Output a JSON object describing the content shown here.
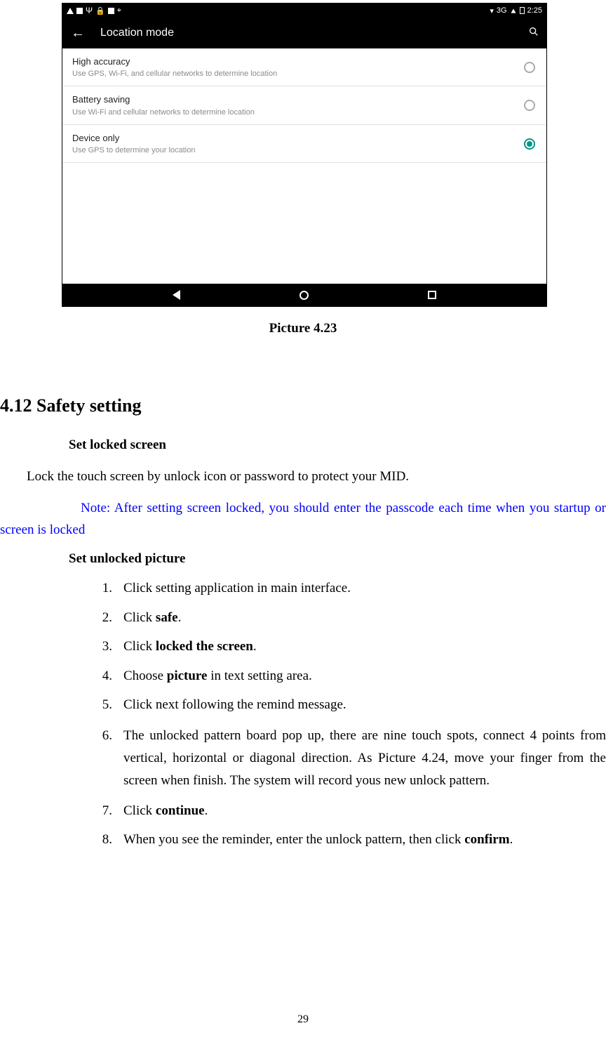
{
  "screenshot": {
    "statusbar": {
      "network": "3G",
      "time": "2:25"
    },
    "appbar": {
      "title": "Location mode"
    },
    "rows": [
      {
        "title": "High accuracy",
        "sub": "Use GPS, Wi-Fi, and cellular networks to determine location",
        "checked": false
      },
      {
        "title": "Battery saving",
        "sub": "Use Wi-Fi and cellular networks to determine location",
        "checked": false
      },
      {
        "title": "Device only",
        "sub": "Use GPS to determine your location",
        "checked": true
      }
    ]
  },
  "caption": "Picture 4.23",
  "heading": "4.12 Safety setting",
  "set_locked_heading": "Set locked screen",
  "lock_para": "Lock the touch screen by unlock icon or password to protect your MID.",
  "note": "Note: After setting screen locked, you should enter the passcode each time when you startup or screen is locked",
  "set_unlocked_heading": "Set unlocked picture",
  "steps": {
    "s1": "Click setting application in main interface.",
    "s2a": "Click ",
    "s2b": "safe",
    "s2c": ".",
    "s3a": "Click ",
    "s3b": "locked the screen",
    "s3c": ".",
    "s4a": "Choose ",
    "s4b": "picture",
    "s4c": " in text setting area.",
    "s5": "Click next following the remind message.",
    "s6": "The unlocked pattern board pop up, there are nine touch spots, connect 4 points from vertical, horizontal or diagonal direction. As Picture 4.24, move your finger from the screen when finish. The system will record yous new unlock pattern.",
    "s7a": "Click ",
    "s7b": "continue",
    "s7c": ".",
    "s8a": "When you see the reminder, enter the unlock pattern, then click ",
    "s8b": "confirm",
    "s8c": "."
  },
  "nums": {
    "n1": "1.",
    "n2": "2.",
    "n3": "3.",
    "n4": "4.",
    "n5": "5.",
    "n6": "6.",
    "n7": "7.",
    "n8": "8."
  },
  "page_number": "29"
}
